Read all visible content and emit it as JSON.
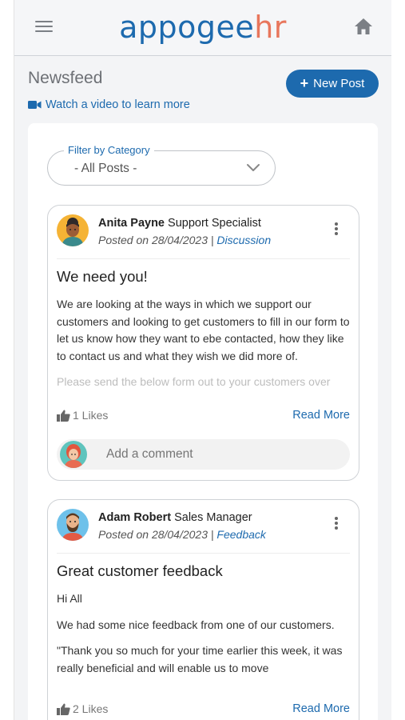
{
  "app": {
    "logo_part1": "appogee",
    "logo_part2": "hr",
    "brand_blue": "#1d6aae",
    "brand_orange": "#e8765c"
  },
  "header": {
    "menu_icon": "hamburger-menu-icon",
    "home_icon": "home-icon"
  },
  "page": {
    "title": "Newsfeed",
    "new_post_label": "New Post",
    "video_link_label": "Watch a video to learn more"
  },
  "filter": {
    "label": "Filter by Category",
    "value": "- All Posts -"
  },
  "posts": [
    {
      "author": "Anita Payne",
      "role": "Support Specialist",
      "posted_prefix": "Posted on 28/04/2023 | ",
      "category": "Discussion",
      "title": "We need you!",
      "body": [
        "We are looking at the ways in which we support our customers and looking to get customers to fill in our form to let us know how they want to ebe contacted, how they like to contact us and what they wish we did more of.",
        "Please send the below form out to your customers over"
      ],
      "likes": "1 Likes",
      "read_more": "Read More",
      "comment_placeholder": "Add a comment"
    },
    {
      "author": "Adam Robert",
      "role": "Sales Manager",
      "posted_prefix": "Posted on 28/04/2023 | ",
      "category": "Feedback",
      "title": "Great customer feedback",
      "body": [
        "Hi All",
        "We had some nice feedback from one of our customers.",
        "\"Thank you so much for your time earlier this week, it was really beneficial and will enable us to move"
      ],
      "likes": "2 Likes",
      "read_more": "Read More"
    }
  ]
}
